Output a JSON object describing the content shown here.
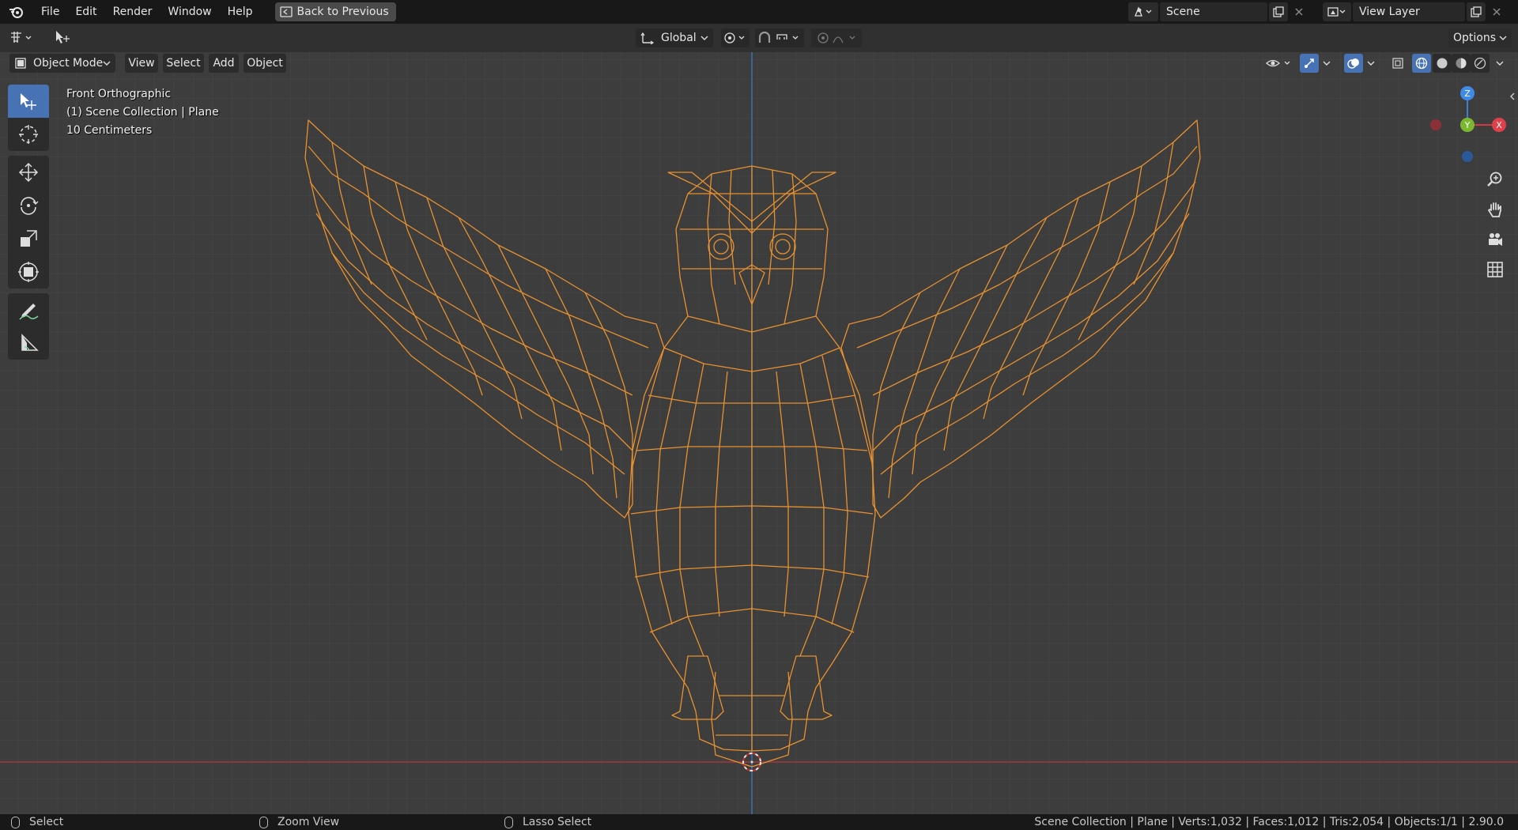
{
  "menu": {
    "items": [
      "File",
      "Edit",
      "Render",
      "Window",
      "Help"
    ],
    "back_button": "Back to Previous"
  },
  "scene": {
    "label": "Scene"
  },
  "view_layer": {
    "label": "View Layer"
  },
  "tool_header": {
    "transform_orientation": "Global",
    "options_label": "Options"
  },
  "view_header": {
    "mode": "Object Mode",
    "menus": [
      "View",
      "Select",
      "Add",
      "Object"
    ]
  },
  "overlay": {
    "view_name": "Front Orthographic",
    "collection": "(1) Scene Collection | Plane",
    "scale": "10 Centimeters"
  },
  "gizmo": {
    "z": "Z",
    "y": "Y",
    "x": "X"
  },
  "toolbar": {
    "tools": [
      "select-box-icon",
      "cursor-icon",
      "move-icon",
      "rotate-icon",
      "scale-icon",
      "transform-icon",
      "annotate-icon",
      "measure-icon"
    ]
  },
  "status": {
    "select": "Select",
    "zoom": "Zoom View",
    "lasso": "Lasso Select",
    "stats": "Scene Collection | Plane | Verts:1,032 | Faces:1,012 | Tris:2,054 | Objects:1/1 | 2.90.0"
  },
  "colors": {
    "wireframe": "#e8912f",
    "grid_bg": "#3d3d3d",
    "axis_x": "#b03a3f",
    "axis_z": "#3c6eb4",
    "active_tool": "#4772b3"
  }
}
